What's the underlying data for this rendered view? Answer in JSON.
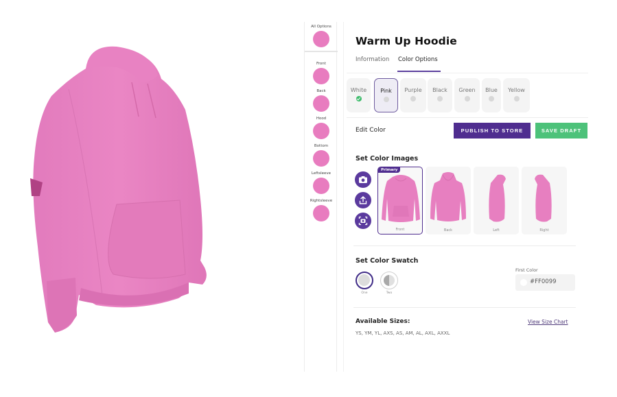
{
  "preview": {
    "garment_color": "#E880C0",
    "view": "3/4 front-left"
  },
  "parts_panel": {
    "all_options": {
      "label": "All Options",
      "color": "#E87CBF"
    },
    "parts": [
      {
        "label": "Front",
        "color": "#E87CBF"
      },
      {
        "label": "Back",
        "color": "#E87CBF"
      },
      {
        "label": "Hood",
        "color": "#E87CBF"
      },
      {
        "label": "Bottom",
        "color": "#E87CBF"
      },
      {
        "label": "Leftsleeve",
        "color": "#E87CBF"
      },
      {
        "label": "Rightsleeve",
        "color": "#E87CBF"
      }
    ]
  },
  "product": {
    "title": "Warm Up Hoodie",
    "tabs": [
      {
        "label": "Information",
        "active": false
      },
      {
        "label": "Color Options",
        "active": true
      }
    ]
  },
  "colors": [
    {
      "label": "White",
      "status": "checked"
    },
    {
      "label": "Pink",
      "status": "selected"
    },
    {
      "label": "Purple",
      "status": "none"
    },
    {
      "label": "Black",
      "status": "none"
    },
    {
      "label": "Green",
      "status": "none"
    },
    {
      "label": "Blue",
      "status": "none"
    },
    {
      "label": "Yellow",
      "status": "none"
    }
  ],
  "edit_color": {
    "label": "Edit Color",
    "publish_label": "PUBLISH TO STORE",
    "save_draft_label": "SAVE DRAFT"
  },
  "color_images": {
    "title": "Set Color Images",
    "tools": [
      "camera-icon",
      "upload-icon",
      "capture-icon"
    ],
    "primary_badge": "Primary",
    "images": [
      {
        "label": "Front",
        "primary": true
      },
      {
        "label": "Back",
        "primary": false
      },
      {
        "label": "Left",
        "primary": false
      },
      {
        "label": "Right",
        "primary": false
      }
    ]
  },
  "color_swatch": {
    "title": "Set Color Swatch",
    "options": [
      {
        "label": "One",
        "selected": true
      },
      {
        "label": "Two",
        "selected": false
      }
    ],
    "first_color_label": "First Color",
    "first_color_value": "#FF0099"
  },
  "sizes": {
    "title": "Available Sizes:",
    "list": "YS, YM, YL, AXS, AS, AM, AL, AXL, AXXL",
    "size_chart_link": "View Size Chart"
  },
  "theme": {
    "accent": "#4F2D8F",
    "success": "#4DC27A",
    "pink": "#E87CBF"
  }
}
